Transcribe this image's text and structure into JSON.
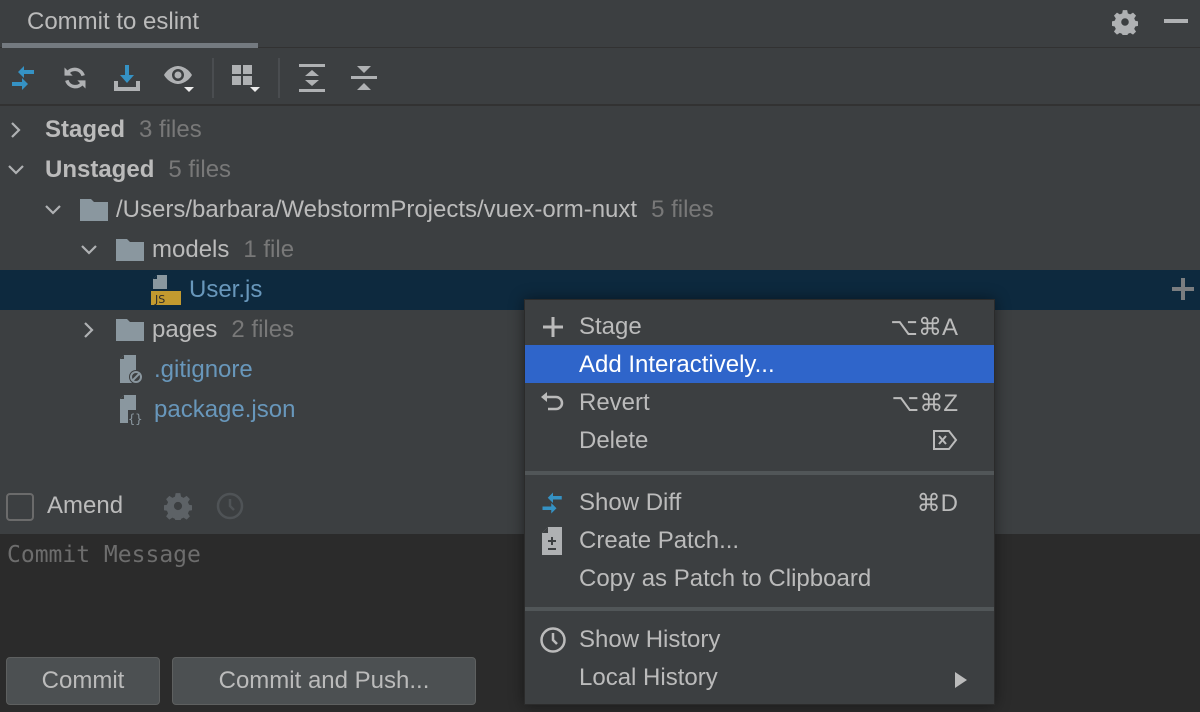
{
  "header": {
    "tab_label": "Commit to eslint",
    "settings_icon": "gear-icon",
    "minimize_icon": "minimize-icon"
  },
  "toolbar": {
    "buttons": [
      {
        "name": "show-diff",
        "icon": "diff-arrows-icon"
      },
      {
        "name": "refresh",
        "icon": "refresh-icon"
      },
      {
        "name": "update-project",
        "icon": "download-icon"
      },
      {
        "name": "view-options",
        "icon": "eye-icon"
      },
      {
        "name": "group-by",
        "icon": "group-by-icon"
      },
      {
        "name": "expand-all",
        "icon": "expand-all-icon"
      },
      {
        "name": "collapse-all",
        "icon": "collapse-all-icon"
      }
    ]
  },
  "tree": {
    "staged": {
      "label": "Staged",
      "count": "3 files",
      "expanded": false
    },
    "unstaged": {
      "label": "Unstaged",
      "count": "5 files",
      "expanded": true
    },
    "root_folder": {
      "label": "/Users/barbara/WebstormProjects/vuex-orm-nuxt",
      "count": "5 files"
    },
    "models_folder": {
      "label": "models",
      "count": "1 file"
    },
    "user_file": {
      "label": "User.js",
      "badge": "JS"
    },
    "pages_folder": {
      "label": "pages",
      "count": "2 files"
    },
    "gitignore_file": {
      "label": ".gitignore"
    },
    "package_file": {
      "label": "package.json"
    }
  },
  "amend": {
    "label": "Amend",
    "checked": false
  },
  "commit_message": {
    "placeholder": "Commit Message"
  },
  "buttons": {
    "commit": "Commit",
    "commit_and_push": "Commit and Push..."
  },
  "context_menu": {
    "groups": [
      [
        {
          "label": "Stage",
          "shortcut": "⌥⌘A",
          "icon": "plus-icon"
        },
        {
          "label": "Add Interactively...",
          "shortcut": "",
          "icon": "",
          "active": true
        },
        {
          "label": "Revert",
          "shortcut": "⌥⌘Z",
          "icon": "revert-icon"
        },
        {
          "label": "Delete",
          "shortcut": "⌦",
          "icon": ""
        }
      ],
      [
        {
          "label": "Show Diff",
          "shortcut": "⌘D",
          "icon": "diff-arrows-icon"
        },
        {
          "label": "Create Patch...",
          "shortcut": "",
          "icon": "patch-icon"
        },
        {
          "label": "Copy as Patch to Clipboard",
          "shortcut": "",
          "icon": ""
        }
      ],
      [
        {
          "label": "Show History",
          "shortcut": "",
          "icon": "clock-icon"
        },
        {
          "label": "Local History",
          "shortcut": "",
          "icon": "",
          "submenu": true
        }
      ]
    ]
  },
  "colors": {
    "background": "#3c3f41",
    "selection": "#0d293e",
    "menu_highlight": "#2f65ca",
    "accent_blue": "#3592c4",
    "file_blue": "#6897bb",
    "editor_bg": "#2b2b2b",
    "js_badge": "#c29a2f"
  }
}
